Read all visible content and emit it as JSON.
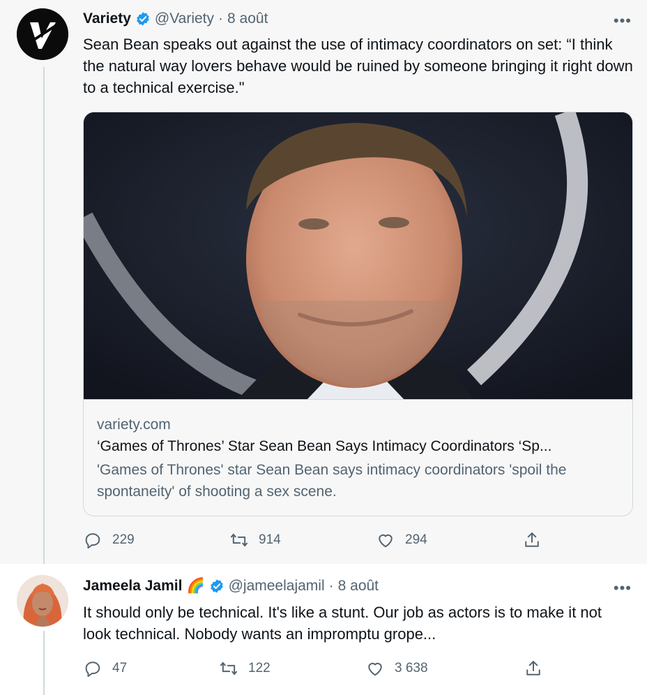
{
  "tweets": [
    {
      "author_name": "Variety",
      "handle": "@Variety",
      "separator": "·",
      "date": "8 août",
      "more": "•••",
      "text": "Sean Bean speaks out against the  use of intimacy coordinators on set: “I think the natural way lovers behave would be ruined by someone bringing it right down to a technical exercise.\"",
      "card": {
        "domain": "variety.com",
        "title": "‘Games of Thrones’ Star Sean Bean Says Intimacy Coordinators ‘Sp...",
        "description": "'Games of Thrones' star Sean Bean says intimacy coordinators 'spoil the spontaneity' of shooting a sex scene."
      },
      "actions": {
        "replies": "229",
        "retweets": "914",
        "likes": "294"
      }
    },
    {
      "author_name": "Jameela Jamil",
      "emoji": "🌈",
      "handle": "@jameelajamil",
      "separator": "·",
      "date": "8 août",
      "more": "•••",
      "text": "It should only be technical. It's like a stunt. Our job as actors is to make it not look technical. Nobody wants an impromptu grope...",
      "actions": {
        "replies": "47",
        "retweets": "122",
        "likes": "3 638"
      }
    }
  ],
  "colors": {
    "verified": "#1d9bf0",
    "secondary_text": "#536471",
    "border": "#cfd9de"
  }
}
